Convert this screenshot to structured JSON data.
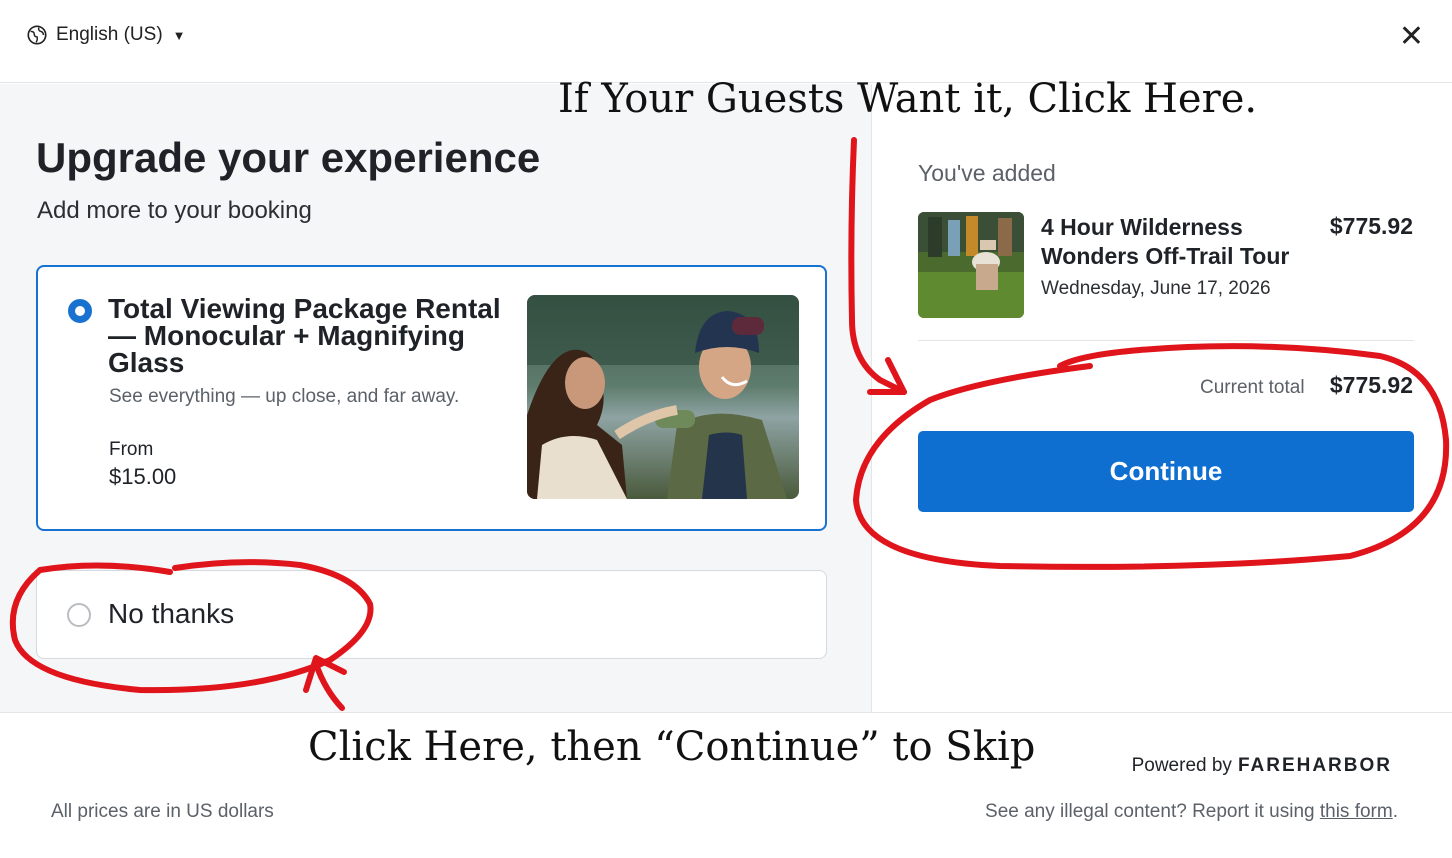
{
  "header": {
    "language": "English (US)"
  },
  "upgrade": {
    "title": "Upgrade your experience",
    "subtitle": "Add more to your booking",
    "option": {
      "title": "Total Viewing Package Rental — Monocular + Magnifying Glass",
      "description": "See everything — up close, and far away.",
      "from_label": "From",
      "price": "$15.00",
      "selected": true
    },
    "no_thanks": {
      "label": "No thanks",
      "selected": false
    }
  },
  "summary": {
    "heading": "You've added",
    "item": {
      "name": "4 Hour Wilderness Wonders Off-Trail Tour",
      "date": "Wednesday, June 17, 2026",
      "price": "$775.92"
    },
    "total_label": "Current total",
    "total_value": "$775.92",
    "continue_label": "Continue"
  },
  "footer": {
    "prices_note": "All prices are in US dollars",
    "powered_by": "Powered by",
    "brand": "FAREHARBOR",
    "report_text": "See any illegal content? Report it using",
    "report_link": "this form",
    "report_end": "."
  },
  "annotations": {
    "top": "If Your Guests Want it, Click Here.",
    "bottom": "Click Here, then “Continue” to Skip",
    "color": "#e0141b"
  },
  "colors": {
    "accent": "#0e6fd1",
    "selected_border": "#1a72d0"
  }
}
